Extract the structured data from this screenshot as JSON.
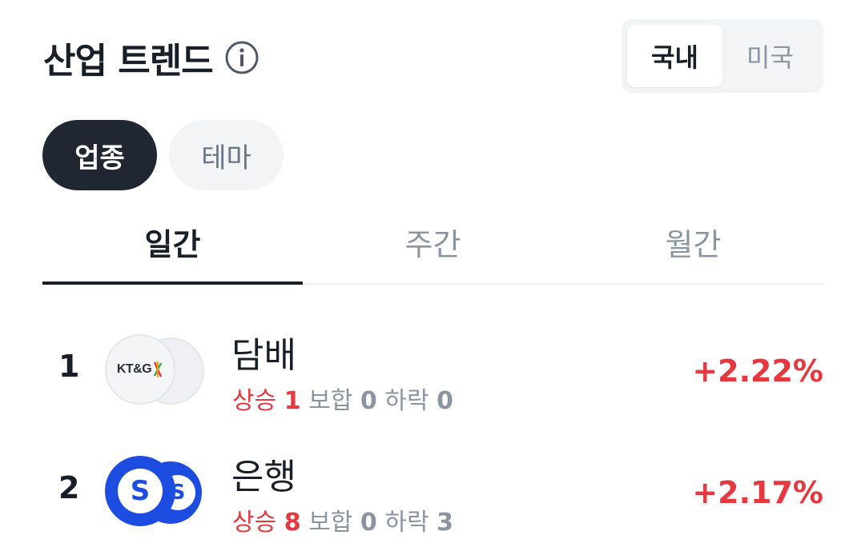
{
  "header": {
    "title": "산업 트렌드",
    "info_icon": "info-circle-icon"
  },
  "market_toggle": {
    "options": [
      "국내",
      "미국"
    ],
    "selected": "국내"
  },
  "category_pills": {
    "options": [
      "업종",
      "테마"
    ],
    "selected": "업종"
  },
  "period_tabs": {
    "options": [
      "일간",
      "주간",
      "월간"
    ],
    "selected": "일간"
  },
  "industries": [
    {
      "rank": "1",
      "name": "담배",
      "logo": "KT&G",
      "up_label": "상승",
      "up_count": "1",
      "flat_label": "보합",
      "flat_count": "0",
      "down_label": "하락",
      "down_count": "0",
      "change": "+2.22%"
    },
    {
      "rank": "2",
      "name": "은행",
      "logo": "S",
      "up_label": "상승",
      "up_count": "8",
      "flat_label": "보합",
      "flat_count": "0",
      "down_label": "하락",
      "down_count": "3",
      "change": "+2.17%"
    }
  ],
  "colors": {
    "up": "#e5383f",
    "bank_brand": "#1d4de0",
    "active_pill": "#202632"
  }
}
